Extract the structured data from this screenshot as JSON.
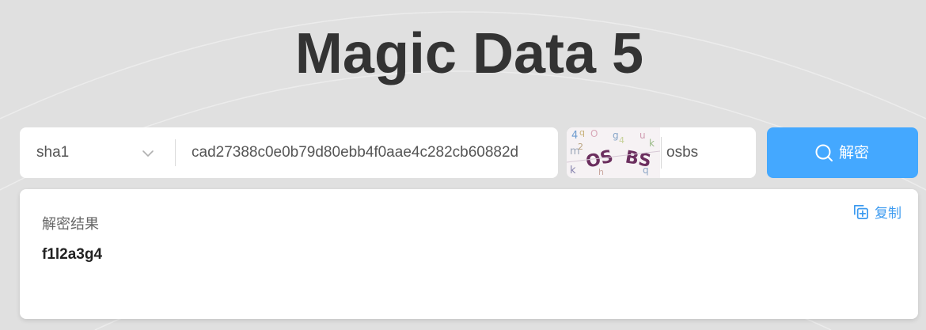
{
  "header": {
    "title": "Magic Data 5"
  },
  "form": {
    "hash_type": "sha1",
    "hash_value": "cad27388c0e0b79d80ebb4f0aae4c282cb60882d",
    "captcha_value": "osbs",
    "captcha_text": "OS BS",
    "decrypt_label": "解密"
  },
  "result": {
    "label": "解密结果",
    "value": "f1l2a3g4",
    "copy_label": "复制"
  },
  "colors": {
    "background": "#e0e0e0",
    "accent": "#44a8ff",
    "link": "#3d9bf0",
    "title": "#333333"
  },
  "icons": {
    "select": "chevron-down-icon",
    "decrypt": "search-icon",
    "copy": "copy-icon"
  }
}
